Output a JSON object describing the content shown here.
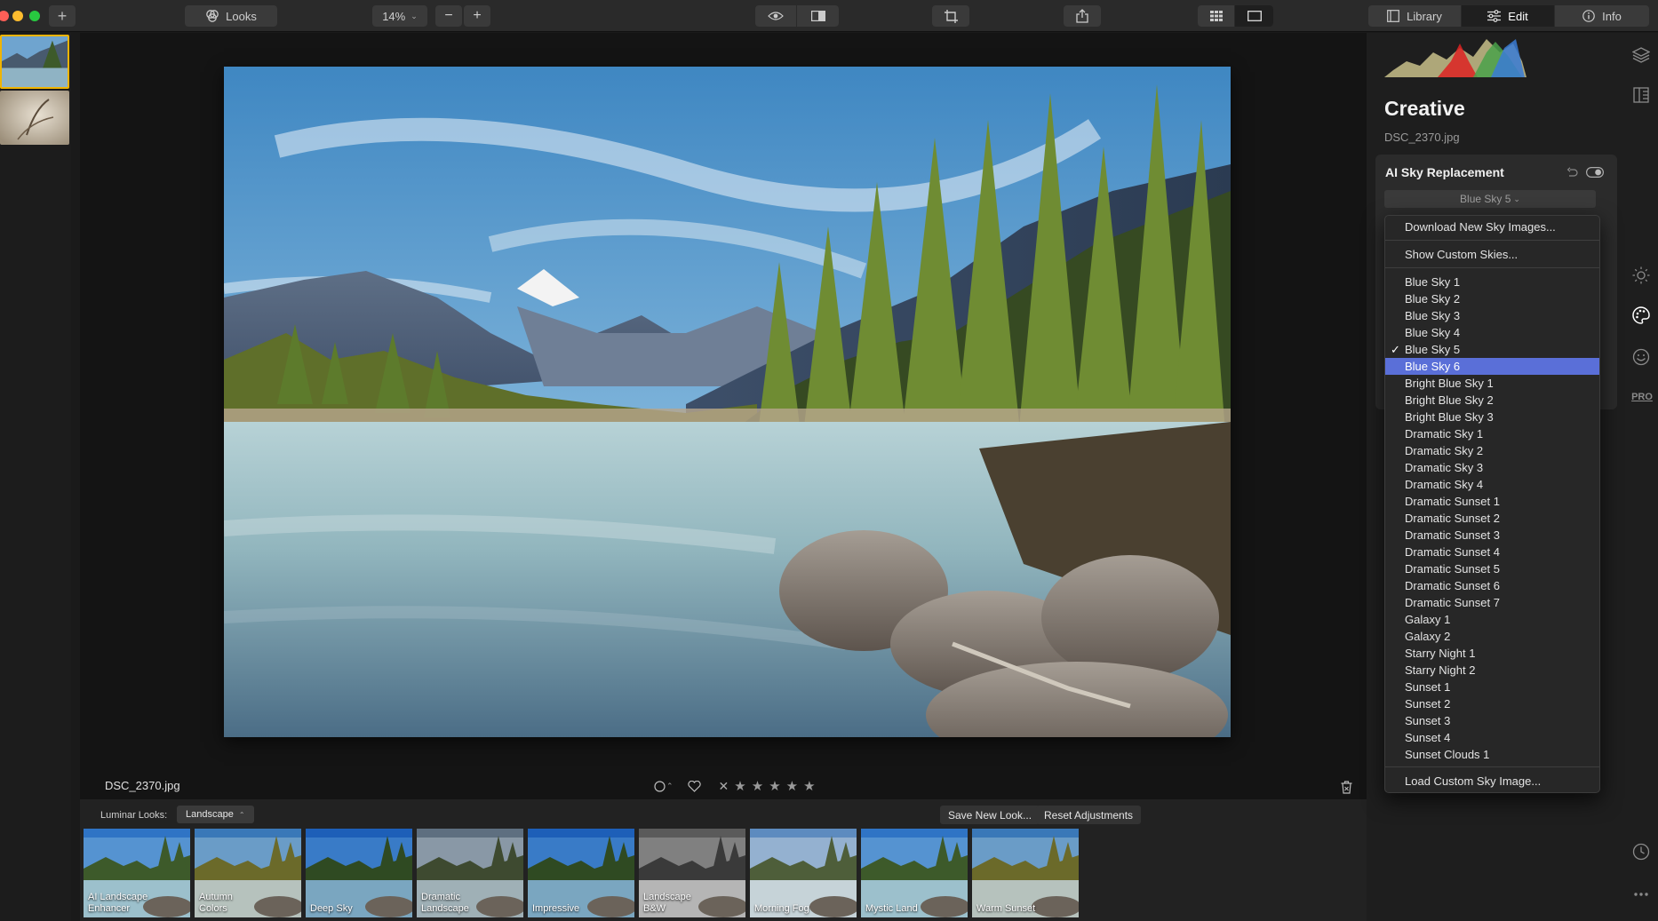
{
  "toolbar": {
    "add_label": "+",
    "looks_label": "Looks",
    "zoom_value": "14%",
    "zoom_out": "−",
    "zoom_in": "+",
    "tabs": [
      {
        "label": "Library",
        "icon": "library-icon",
        "active": false
      },
      {
        "label": "Edit",
        "icon": "sliders-icon",
        "active": true
      },
      {
        "label": "Info",
        "icon": "info-icon",
        "active": false
      }
    ]
  },
  "image": {
    "filename": "DSC_2370.jpg"
  },
  "rating": {
    "stars": [
      "★",
      "★",
      "★",
      "★",
      "★"
    ]
  },
  "looks_panel": {
    "label": "Luminar Looks:",
    "category": "Landscape",
    "save_button": "Save New Look...",
    "reset_button": "Reset Adjustments",
    "looks": [
      {
        "name": "AI Landscape Enhancer",
        "line1": "AI Landscape",
        "line2": "Enhancer",
        "style": "color"
      },
      {
        "name": "Autumn Colors",
        "line1": "Autumn",
        "line2": "Colors",
        "style": "warm"
      },
      {
        "name": "Deep Sky",
        "line1": "",
        "line2": "Deep Sky",
        "style": "deep"
      },
      {
        "name": "Dramatic Landscape",
        "line1": "Dramatic",
        "line2": "Landscape",
        "style": "drama"
      },
      {
        "name": "Impressive",
        "line1": "",
        "line2": "Impressive",
        "style": "deep"
      },
      {
        "name": "Landscape B&W",
        "line1": "Landscape",
        "line2": "B&W",
        "style": "bw"
      },
      {
        "name": "Morning Fog",
        "line1": "",
        "line2": "Morning Fog",
        "style": "fog"
      },
      {
        "name": "Mystic Land",
        "line1": "",
        "line2": "Mystic Land",
        "style": "color"
      },
      {
        "name": "Warm Sunset",
        "line1": "",
        "line2": "Warm Sunset",
        "style": "warm"
      }
    ]
  },
  "right_panel": {
    "title": "Creative",
    "filename": "DSC_2370.jpg",
    "tool_name": "AI Sky Replacement",
    "sky_selected": "Blue Sky 5"
  },
  "sky_menu": {
    "actions_top": [
      "Download New Sky Images...",
      "Show Custom Skies..."
    ],
    "items": [
      "Blue Sky 1",
      "Blue Sky 2",
      "Blue Sky 3",
      "Blue Sky 4",
      "Blue Sky 5",
      "Blue Sky 6",
      "Bright Blue Sky 1",
      "Bright Blue Sky 2",
      "Bright Blue Sky 3",
      "Dramatic Sky 1",
      "Dramatic Sky 2",
      "Dramatic Sky 3",
      "Dramatic Sky 4",
      "Dramatic Sunset 1",
      "Dramatic Sunset 2",
      "Dramatic Sunset 3",
      "Dramatic Sunset 4",
      "Dramatic Sunset 5",
      "Dramatic Sunset 6",
      "Dramatic Sunset 7",
      "Galaxy 1",
      "Galaxy 2",
      "Starry Night 1",
      "Starry Night 2",
      "Sunset 1",
      "Sunset 2",
      "Sunset 3",
      "Sunset 4",
      "Sunset Clouds 1"
    ],
    "checked": "Blue Sky 5",
    "highlighted": "Blue Sky 6",
    "action_bottom": "Load Custom Sky Image...",
    "check_glyph": "✓"
  },
  "right_rail": {
    "pro_label": "PRO"
  },
  "colors": {
    "accent": "#5a6fd8",
    "selected_border": "#f0b400",
    "traffic_red": "#ff5f57",
    "traffic_yellow": "#febc2e",
    "traffic_green": "#28c840"
  }
}
